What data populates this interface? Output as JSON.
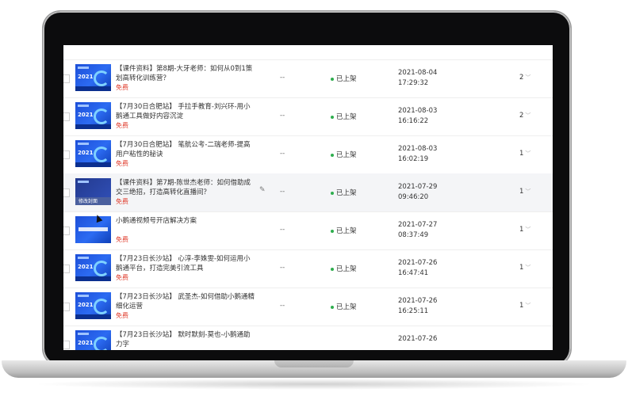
{
  "rows": [
    {
      "title": "【课件资料】第8期-大牙老师：如何从0到1策划高转化训练营？",
      "price": "免费",
      "dash": "--",
      "status": "已上架",
      "date": "2021-08-04",
      "time": "17:29:32",
      "count": "2",
      "thumb": "cover"
    },
    {
      "title": "【7月30日合肥站】 手拉手教育-刘兴环-用小鹅通工具做好内容沉淀",
      "price": "免费",
      "dash": "--",
      "status": "已上架",
      "date": "2021-08-03",
      "time": "16:16:22",
      "count": "2",
      "thumb": "cover"
    },
    {
      "title": "【7月30日合肥站】 笔航公考-二瑞老师-提高用户粘性的秘诀",
      "price": "免费",
      "dash": "--",
      "status": "已上架",
      "date": "2021-08-03",
      "time": "16:02:19",
      "count": "1",
      "thumb": "cover"
    },
    {
      "title": "【课件资料】第7期-陈世杰老师：如何借助成交三绝招，打造高转化直播间？",
      "price": "免费",
      "dash": "--",
      "status": "已上架",
      "date": "2021-07-29",
      "time": "09:46:20",
      "count": "1",
      "thumb": "dark",
      "thumb_caption": "修改封面"
    },
    {
      "title": "小鹅通视频号开店解决方案",
      "price": "免费",
      "dash": "--",
      "status": "已上架",
      "date": "2021-07-27",
      "time": "08:37:49",
      "count": "1",
      "thumb": "plain"
    },
    {
      "title": "【7月23日长沙站】 心淳-李姝雯-如何运用小鹅通平台，打造完美引流工具",
      "price": "免费",
      "dash": "--",
      "status": "已上架",
      "date": "2021-07-26",
      "time": "16:47:41",
      "count": "1",
      "thumb": "cover"
    },
    {
      "title": "【7月23日长沙站】 武圣杰-如何借助小鹅通精细化运营",
      "price": "免费",
      "dash": "--",
      "status": "已上架",
      "date": "2021-07-26",
      "time": "16:25:11",
      "count": "1",
      "thumb": "cover"
    },
    {
      "title": "【7月23日长沙站】 默时默刻-莫也-小鹅通助力字",
      "price": "",
      "dash": "",
      "status": "",
      "date": "2021-07-26",
      "time": "",
      "count": "",
      "thumb": "cover"
    }
  ],
  "thumb_year": "2021",
  "icons": {
    "edit": "pencil-icon",
    "chevron": "chevron-down-icon",
    "cursor": "mouse-cursor-icon"
  },
  "colors": {
    "status_dot": "#2fae4e",
    "price": "#e03b2b",
    "thumb_blue": "#2c6bf2"
  }
}
